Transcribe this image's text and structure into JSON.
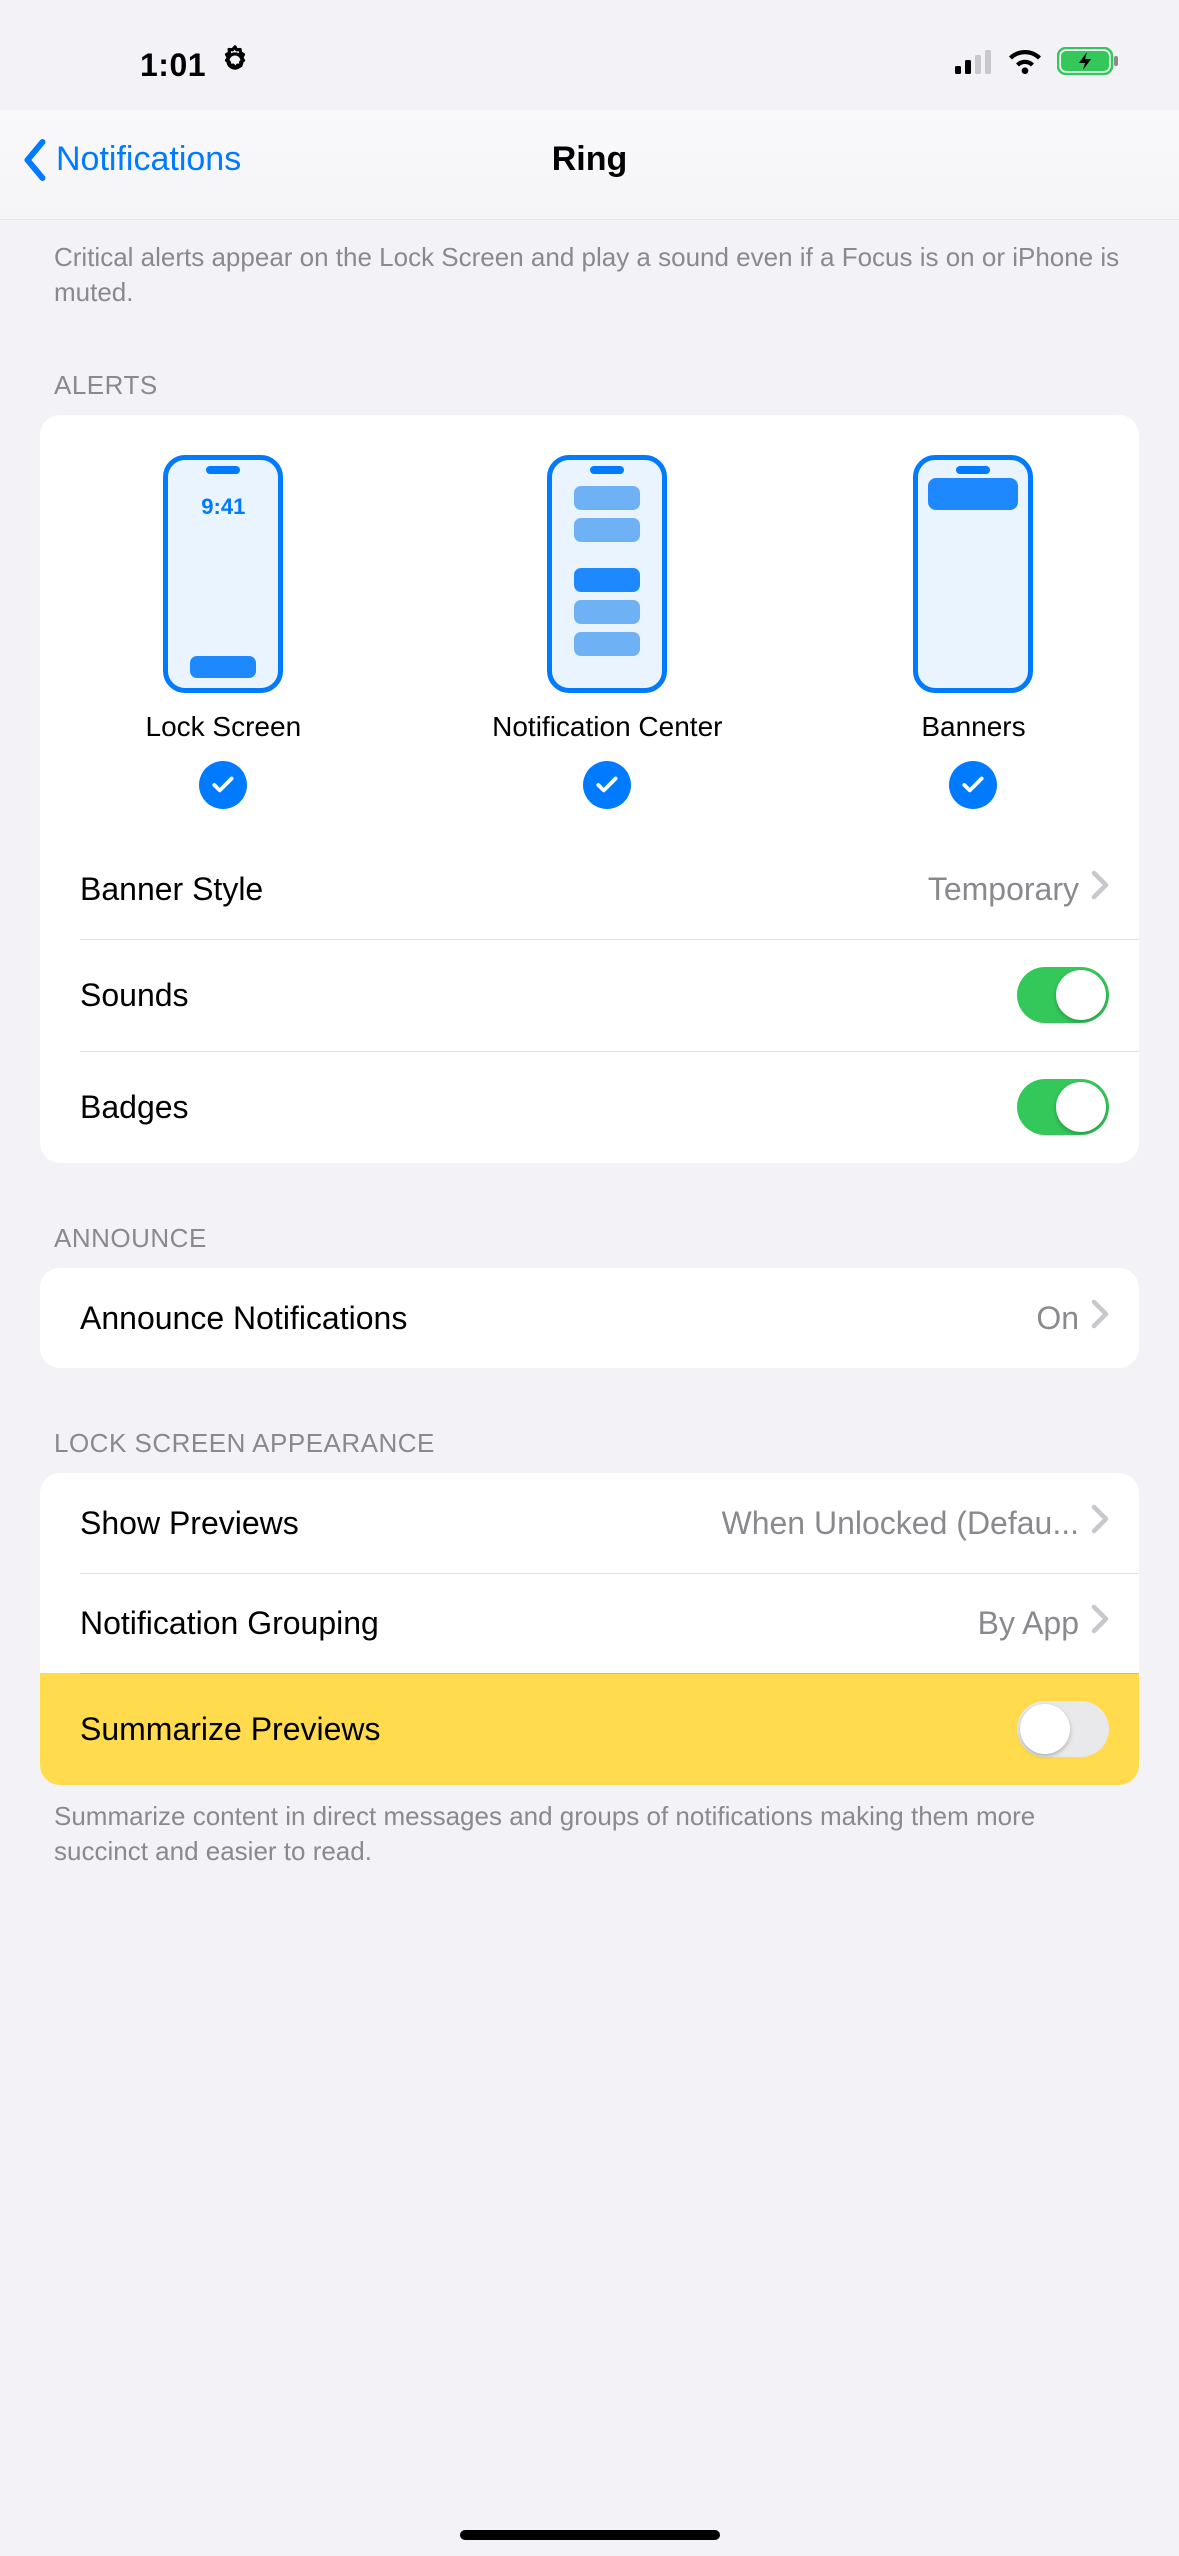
{
  "status": {
    "time": "1:01"
  },
  "nav": {
    "back_label": "Notifications",
    "title": "Ring"
  },
  "critical_footer": "Critical alerts appear on the Lock Screen and play a sound even if a Focus is on or iPhone is muted.",
  "alerts": {
    "header": "ALERTS",
    "options": [
      {
        "label": "Lock Screen",
        "preview_time": "9:41",
        "checked": true
      },
      {
        "label": "Notification Center",
        "checked": true
      },
      {
        "label": "Banners",
        "checked": true
      }
    ],
    "banner_style": {
      "label": "Banner Style",
      "value": "Temporary"
    },
    "sounds": {
      "label": "Sounds",
      "on": true
    },
    "badges": {
      "label": "Badges",
      "on": true
    }
  },
  "announce": {
    "header": "ANNOUNCE",
    "row": {
      "label": "Announce Notifications",
      "value": "On"
    }
  },
  "lockscreen": {
    "header": "LOCK SCREEN APPEARANCE",
    "show_previews": {
      "label": "Show Previews",
      "value": "When Unlocked (Defau..."
    },
    "grouping": {
      "label": "Notification Grouping",
      "value": "By App"
    },
    "summarize": {
      "label": "Summarize Previews",
      "on": false
    },
    "footer": "Summarize content in direct messages and groups of notifications making them more succinct and easier to read."
  }
}
